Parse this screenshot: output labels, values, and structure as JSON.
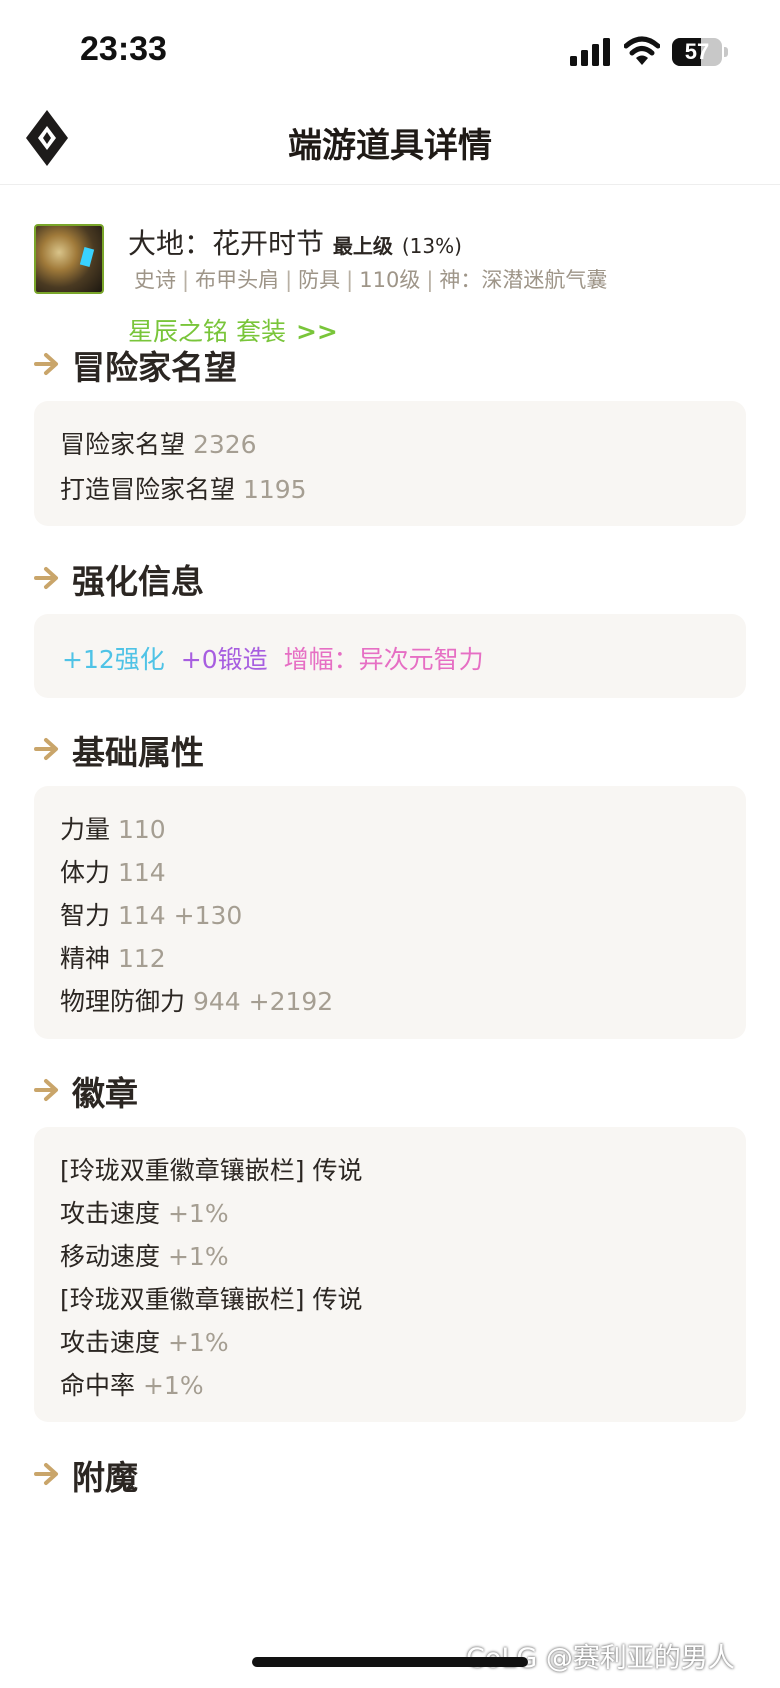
{
  "status_bar": {
    "time": "23:33",
    "battery": "57",
    "battery_level_percent": 57
  },
  "header": {
    "title": "端游道具详情",
    "logo_icon": "diamond-logo-icon"
  },
  "item": {
    "name": "大地：花开时节",
    "grade": "最上级",
    "grade_percent": "(13%)",
    "attributes": [
      "史诗",
      "布甲头肩",
      "防具",
      "110级",
      "神：深潜迷航气囊"
    ],
    "set_name": "星辰之铭 套装",
    "set_arrow": ">>",
    "set_color": "#79c53a",
    "icon": "shoulder-armor-icon"
  },
  "sections": {
    "reputation": {
      "title": "冒险家名望",
      "rows": [
        {
          "label": "冒险家名望",
          "value": "2326"
        },
        {
          "label": "打造冒险家名望",
          "value": "1195"
        }
      ]
    },
    "enhance": {
      "title": "强化信息",
      "chips": [
        {
          "text": "+12强化",
          "color": "#4fc3e6"
        },
        {
          "text": "+0锻造",
          "color": "#a75ee0"
        },
        {
          "text": "增幅：异次元智力",
          "color": "#e66fc4"
        }
      ]
    },
    "base_attributes": {
      "title": "基础属性",
      "rows": [
        {
          "label": "力量",
          "value": "110"
        },
        {
          "label": "体力",
          "value": "114"
        },
        {
          "label": "智力",
          "value": "114 +130"
        },
        {
          "label": "精神",
          "value": "112"
        },
        {
          "label": "物理防御力",
          "value": "944 +2192"
        }
      ]
    },
    "emblems": {
      "title": "徽章",
      "rows": [
        {
          "label": "[玲珑双重徽章镶嵌栏] 传说",
          "value": ""
        },
        {
          "label": "攻击速度",
          "value": "+1%"
        },
        {
          "label": "移动速度",
          "value": "+1%"
        },
        {
          "label": "[玲珑双重徽章镶嵌栏] 传说",
          "value": ""
        },
        {
          "label": "攻击速度",
          "value": "+1%"
        },
        {
          "label": "命中率",
          "value": "+1%"
        }
      ]
    },
    "enchant": {
      "title": "附魔"
    }
  },
  "watermark": "CoLG @赛利亚的男人",
  "accent_color": "#c9a56a"
}
